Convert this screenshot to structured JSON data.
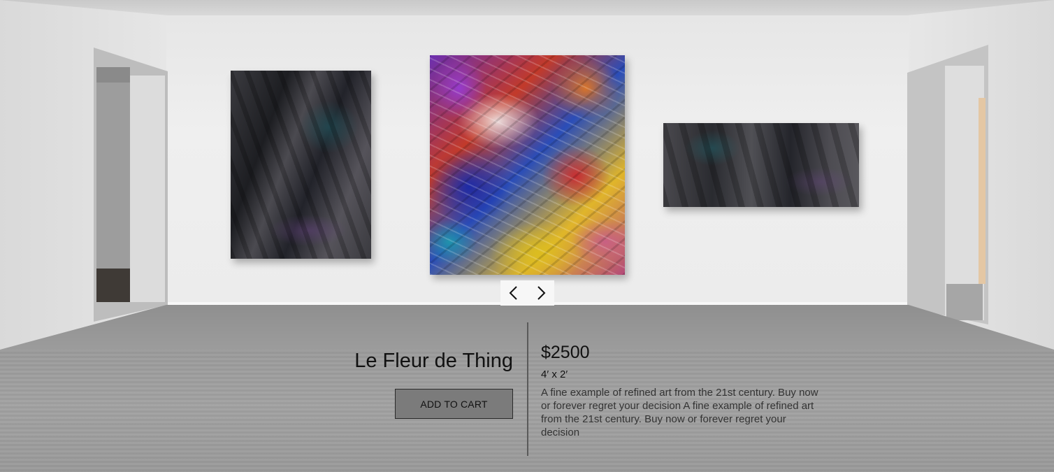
{
  "product": {
    "title": "Le Fleur de Thing",
    "add_to_cart_label": "ADD TO CART",
    "price": "$2500",
    "dimensions": "4′ x 2′",
    "description": "A fine example of refined art from the 21st century. Buy now or forever regret your decision A fine example of refined art from the 21st century. Buy now or forever regret your decision"
  },
  "carousel": {
    "prev_icon": "chevron-left-icon",
    "next_icon": "chevron-right-icon"
  },
  "colors": {
    "button_bg": "#7b7b7b",
    "nav_bg": "#f7f7f7",
    "divider": "#5a5a5a"
  }
}
